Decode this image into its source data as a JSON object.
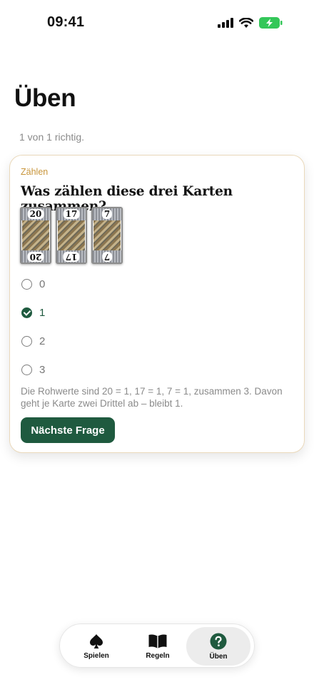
{
  "status_bar": {
    "time": "09:41",
    "battery_color": "#34c759"
  },
  "page": {
    "title": "Üben",
    "score_text": "1 von 1 richtig."
  },
  "question_card": {
    "category": "Zählen",
    "question": "Was zählen diese drei Karten zusammen?",
    "cards": [
      {
        "value": "20"
      },
      {
        "value": "17"
      },
      {
        "value": "7"
      }
    ],
    "options": [
      {
        "label": "0",
        "selected": false
      },
      {
        "label": "1",
        "selected": true
      },
      {
        "label": "2",
        "selected": false
      },
      {
        "label": "3",
        "selected": false
      }
    ],
    "explanation": "Die Rohwerte sind 20 = 1, 17 = 1, 7 = 1, zusammen 3. Davon geht je Karte zwei Drittel ab – bleibt 1.",
    "next_button_label": "Nächste Frage",
    "accent_color": "#1f5a3f",
    "category_color": "#c8953a"
  },
  "tab_bar": {
    "tabs": [
      {
        "label": "Spielen",
        "icon": "spade-icon",
        "active": false
      },
      {
        "label": "Regeln",
        "icon": "book-icon",
        "active": false
      },
      {
        "label": "Üben",
        "icon": "question-circle-icon",
        "active": true
      }
    ]
  }
}
